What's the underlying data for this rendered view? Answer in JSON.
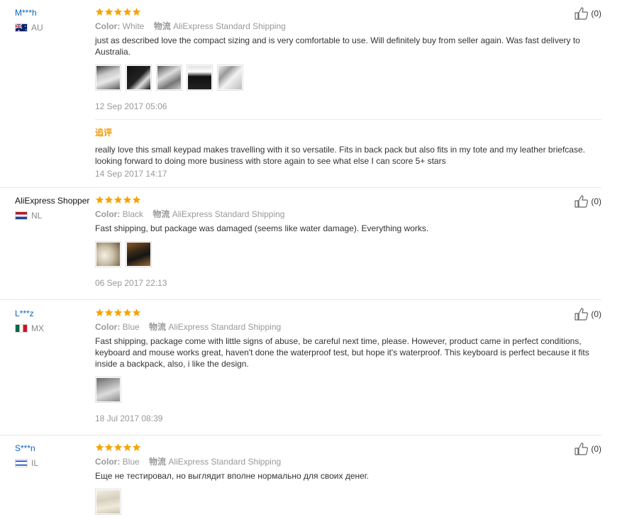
{
  "colors": {
    "username": "#0b64c0",
    "star": "#f7a307",
    "followup": "#f39800",
    "muted": "#999999"
  },
  "labels": {
    "color_prefix": "Color:",
    "shipping_prefix": "物流",
    "followup_label": "追评"
  },
  "reviews": [
    {
      "user": "M***h",
      "country": "AU",
      "rating": 5,
      "color": "White",
      "shipping": "AliExpress Standard Shipping",
      "text": "just as described love the compact sizing and is very comfortable to use. Will definitely buy from seller again. Was fast delivery to Australia.",
      "photos": 5,
      "date": "12 Sep 2017 05:06",
      "likes": "(0)",
      "followup": {
        "text": "really love this small keypad makes travelling with it so versatile. Fits in back pack but also fits in my tote and my leather briefcase. looking forward to doing more business with store again to see what else I can score 5+ stars",
        "date": "14 Sep 2017 14:17"
      }
    },
    {
      "user": "AliExpress Shopper",
      "country": "NL",
      "rating": 5,
      "color": "Black",
      "shipping": "AliExpress Standard Shipping",
      "text": "Fast shipping, but package was damaged (seems like water damage). Everything works.",
      "photos": 2,
      "date": "06 Sep 2017 22:13",
      "likes": "(0)"
    },
    {
      "user": "L***z",
      "country": "MX",
      "rating": 5,
      "color": "Blue",
      "shipping": "AliExpress Standard Shipping",
      "text": "Fast shipping, package come with little signs of abuse, be careful next time, please. However, product came in perfect conditions, keyboard and mouse works great, haven't done the waterproof test, but hope it's waterproof. This keyboard is perfect because it fits inside a backpack, also, i like the design.",
      "photos": 1,
      "date": "18 Jul 2017 08:39",
      "likes": "(0)"
    },
    {
      "user": "S***n",
      "country": "IL",
      "rating": 5,
      "color": "Blue",
      "shipping": "AliExpress Standard Shipping",
      "text": "Еще не тестировал, но выглядит вполне нормально для своих денег.",
      "photos": 1,
      "likes": "(0)"
    }
  ]
}
